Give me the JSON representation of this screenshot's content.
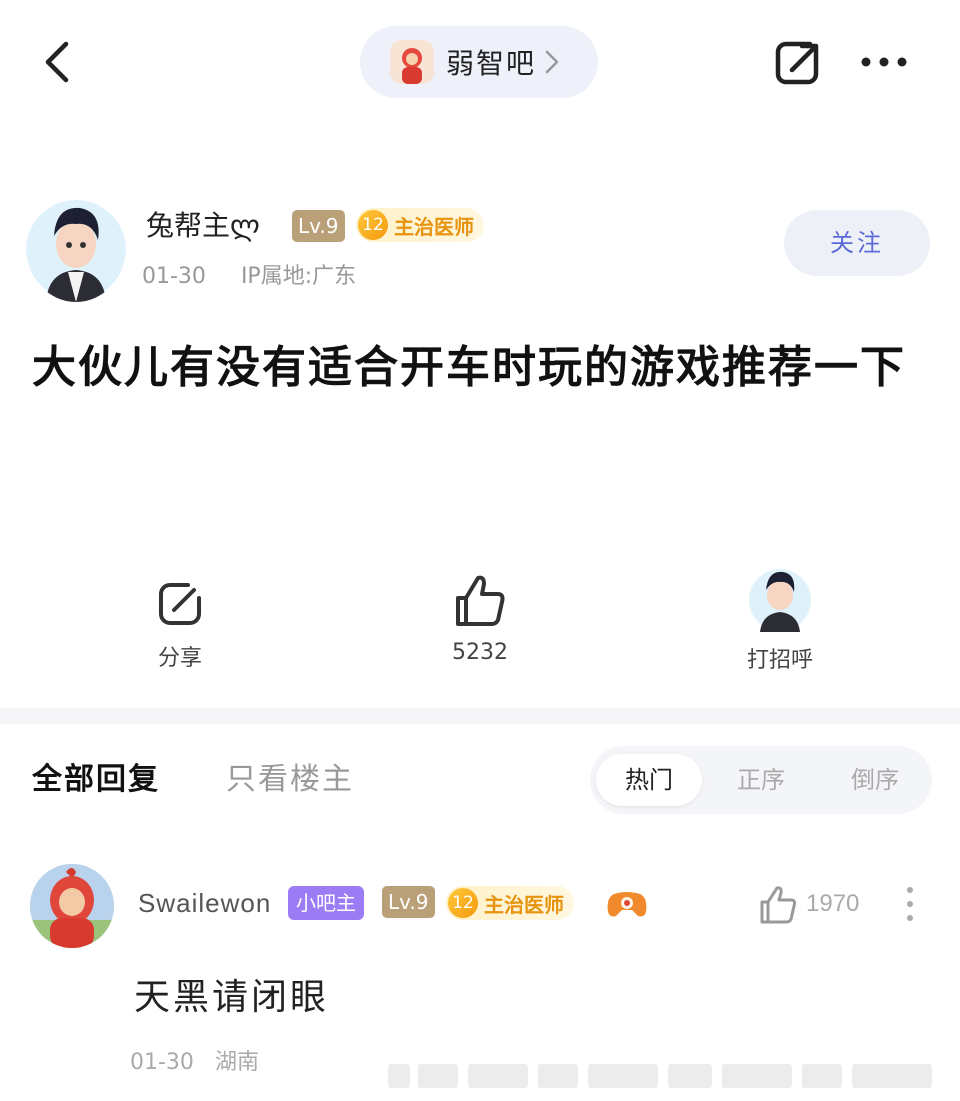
{
  "header": {
    "forum_name": "弱智吧"
  },
  "author": {
    "name": "兔帮主ლ",
    "level": "Lv.9",
    "rank_number": "12",
    "rank_title": "主治医师",
    "date": "01-30",
    "ip_location": "IP属地:广东",
    "follow_label": "关注"
  },
  "post": {
    "title": "大伙儿有没有适合开车时玩的游戏推荐一下"
  },
  "actions": {
    "share_label": "分享",
    "like_count": "5232",
    "greet_label": "打招呼"
  },
  "reply_tabs": {
    "all_label": "全部回复",
    "op_only_label": "只看楼主",
    "sort_options": [
      "热门",
      "正序",
      "倒序"
    ]
  },
  "reply": {
    "username": "Swailewon",
    "role_badge": "小吧主",
    "level": "Lv.9",
    "rank_number": "12",
    "rank_title": "主治医师",
    "like_count": "1970",
    "content": "天黑请闭眼",
    "date": "01-30",
    "location": "湖南"
  },
  "colors": {
    "accent": "#5a6bd8",
    "badge_purple": "#9b7cf5",
    "rank_orange": "#e8930e"
  }
}
